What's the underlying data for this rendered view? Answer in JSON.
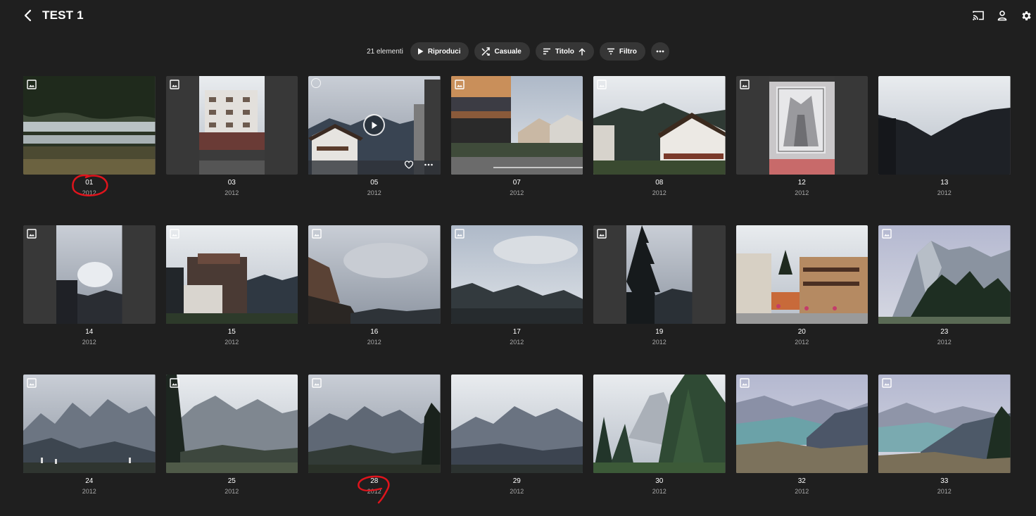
{
  "header": {
    "title": "TEST 1"
  },
  "toolbar": {
    "count": "21 elementi",
    "play_label": "Riproduci",
    "shuffle_label": "Casuale",
    "sort_label": "Titolo",
    "filter_label": "Filtro"
  },
  "colors": {
    "background": "#1f1f1f",
    "button_bg": "#363636",
    "annotation": "#e0141c"
  },
  "items": [
    {
      "title": "01",
      "year": "2012"
    },
    {
      "title": "03",
      "year": "2012"
    },
    {
      "title": "05",
      "year": "2012"
    },
    {
      "title": "07",
      "year": "2012"
    },
    {
      "title": "08",
      "year": "2012"
    },
    {
      "title": "12",
      "year": "2012"
    },
    {
      "title": "13",
      "year": "2012"
    },
    {
      "title": "14",
      "year": "2012"
    },
    {
      "title": "15",
      "year": "2012"
    },
    {
      "title": "16",
      "year": "2012"
    },
    {
      "title": "17",
      "year": "2012"
    },
    {
      "title": "19",
      "year": "2012"
    },
    {
      "title": "20",
      "year": "2012"
    },
    {
      "title": "23",
      "year": "2012"
    },
    {
      "title": "24",
      "year": "2012"
    },
    {
      "title": "25",
      "year": "2012"
    },
    {
      "title": "28",
      "year": "2012"
    },
    {
      "title": "29",
      "year": "2012"
    },
    {
      "title": "30",
      "year": "2012"
    },
    {
      "title": "32",
      "year": "2012"
    },
    {
      "title": "33",
      "year": "2012"
    }
  ]
}
